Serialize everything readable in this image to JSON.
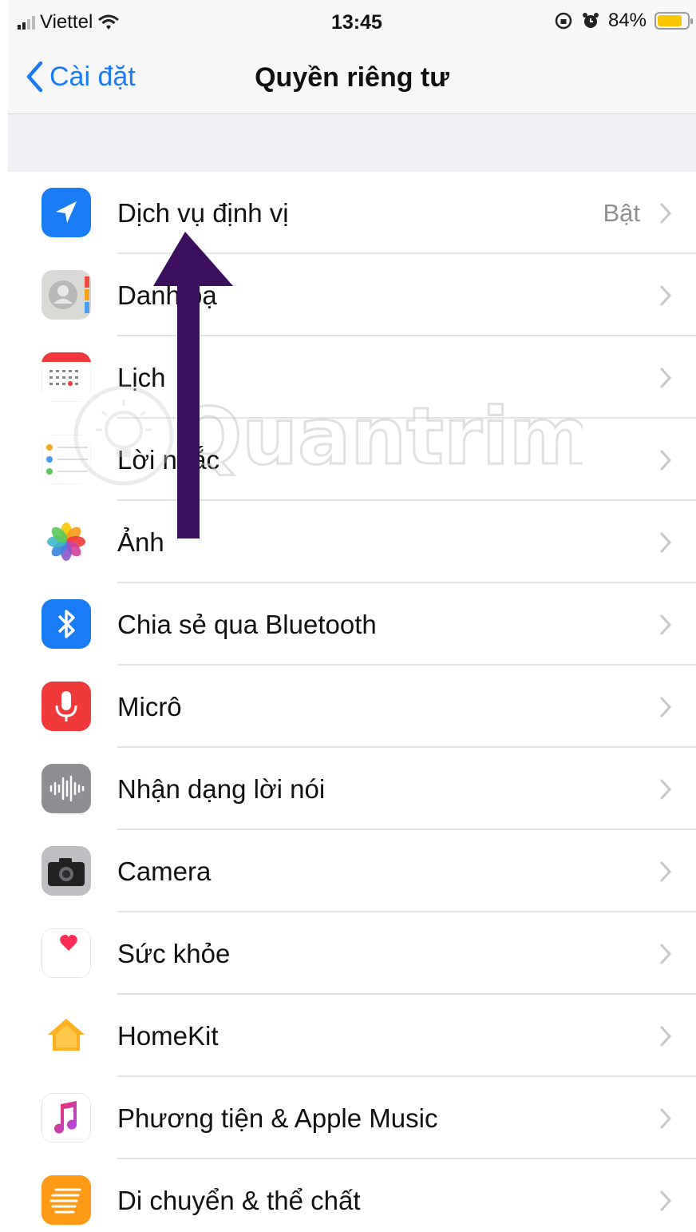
{
  "status_bar": {
    "carrier": "Viettel",
    "time": "13:45",
    "battery_percent": "84%",
    "battery_level": 0.84,
    "icons": [
      "signal-icon",
      "wifi-icon",
      "orientation-lock-icon",
      "alarm-icon",
      "battery-icon"
    ]
  },
  "nav": {
    "back_label": "Cài đặt",
    "title": "Quyền riêng tư"
  },
  "items": [
    {
      "label": "Dịch vụ định vị",
      "value": "Bật",
      "icon": "location-icon",
      "color": "#1a7cf5"
    },
    {
      "label": "Danh bạ",
      "value": "",
      "icon": "contacts-icon",
      "color": "#d9d9d6"
    },
    {
      "label": "Lịch",
      "value": "",
      "icon": "calendar-icon",
      "color": "#ffffff"
    },
    {
      "label": "Lời nhắc",
      "value": "",
      "icon": "reminders-icon",
      "color": "#ffffff"
    },
    {
      "label": "Ảnh",
      "value": "",
      "icon": "photos-icon",
      "color": "#ffffff"
    },
    {
      "label": "Chia sẻ qua Bluetooth",
      "value": "",
      "icon": "bluetooth-icon",
      "color": "#1a7cf5"
    },
    {
      "label": "Micrô",
      "value": "",
      "icon": "microphone-icon",
      "color": "#f0393a"
    },
    {
      "label": "Nhận dạng lời nói",
      "value": "",
      "icon": "speech-recognition-icon",
      "color": "#8e8e93"
    },
    {
      "label": "Camera",
      "value": "",
      "icon": "camera-icon",
      "color": "#8e8e93"
    },
    {
      "label": "Sức khỏe",
      "value": "",
      "icon": "health-icon",
      "color": "#ffffff"
    },
    {
      "label": "HomeKit",
      "value": "",
      "icon": "homekit-icon",
      "color": "#ffffff"
    },
    {
      "label": "Phương tiện & Apple Music",
      "value": "",
      "icon": "apple-music-icon",
      "color": "#ffffff"
    },
    {
      "label": "Di chuyển & thể chất",
      "value": "",
      "icon": "motion-fitness-icon",
      "color": "#fe9a16"
    }
  ],
  "watermark": "Quantrimang",
  "annotation": "purple-arrow-pointing-up"
}
